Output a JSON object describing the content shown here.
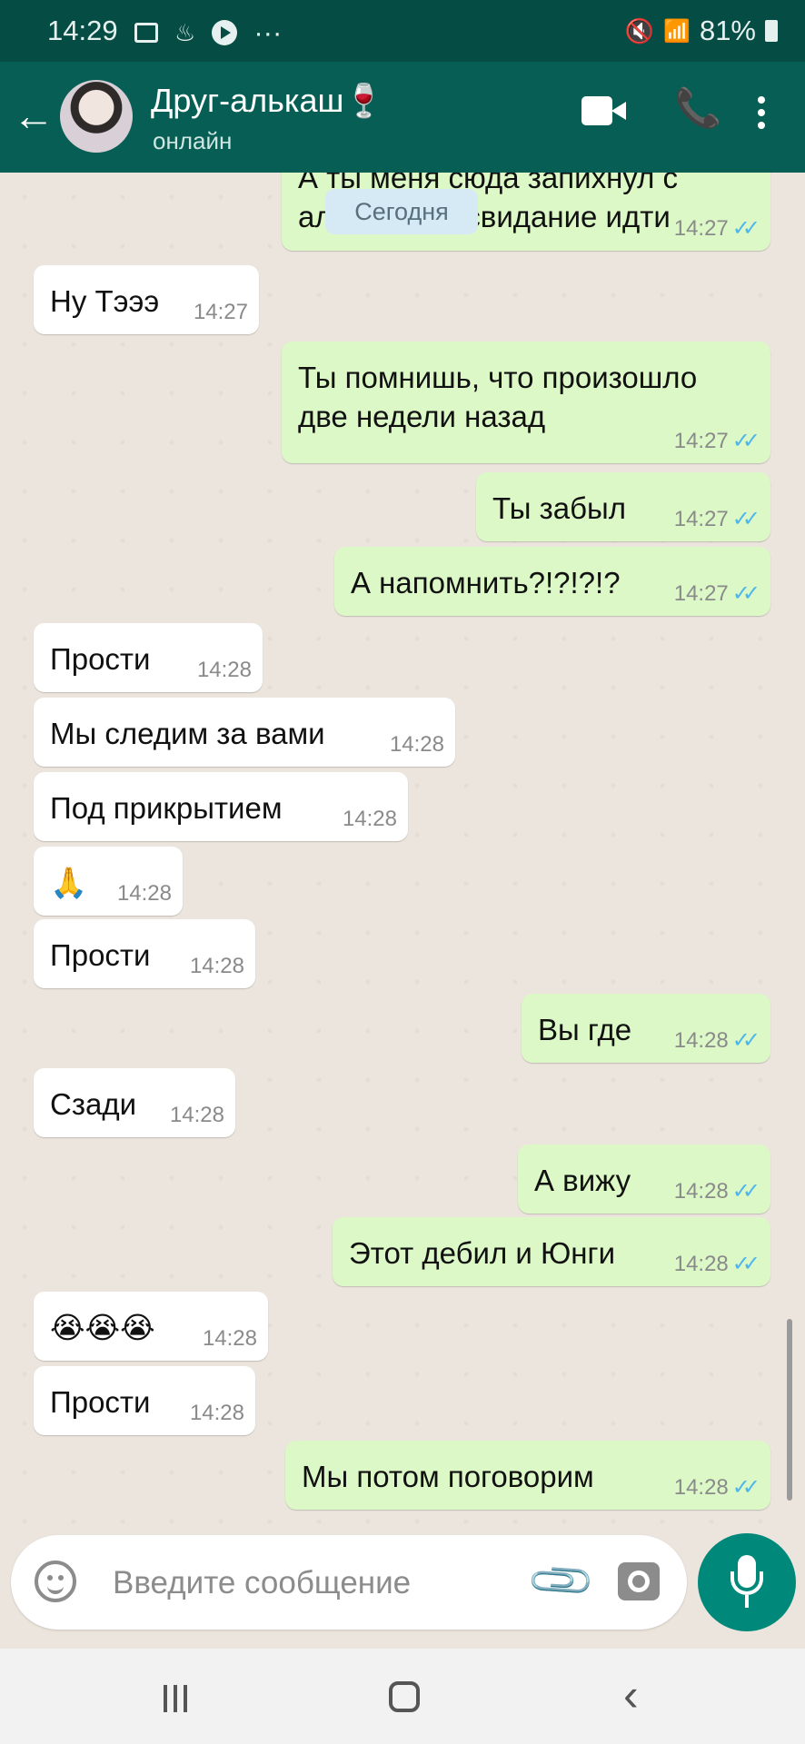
{
  "status_bar": {
    "time": "14:29",
    "more": "···",
    "signal": "📶",
    "battery": "81%"
  },
  "header": {
    "back_icon": "←",
    "contact_name": "Друг-алькаш🍷",
    "status": "онлайн",
    "call_icon": "📞"
  },
  "date_separator": "Сегодня",
  "messages": [
    {
      "dir": "out",
      "text": "А ты меня сюда запихнул с\nал                свидание идти",
      "time": "14:27"
    },
    {
      "dir": "in",
      "text": "Ну Тэээ",
      "time": "14:27"
    },
    {
      "dir": "out",
      "text": "Ты помнишь, что произошло\nдве недели назад",
      "time": "14:27"
    },
    {
      "dir": "out",
      "text": "Ты забыл",
      "time": "14:27"
    },
    {
      "dir": "out",
      "text": "А напомнить?!?!?!?",
      "time": "14:27"
    },
    {
      "dir": "in",
      "text": "Прости",
      "time": "14:28"
    },
    {
      "dir": "in",
      "text": "Мы следим за вами",
      "time": "14:28"
    },
    {
      "dir": "in",
      "text": "Под прикрытием",
      "time": "14:28"
    },
    {
      "dir": "in",
      "text": "🙏",
      "time": "14:28"
    },
    {
      "dir": "in",
      "text": "Прости",
      "time": "14:28"
    },
    {
      "dir": "out",
      "text": "Вы где",
      "time": "14:28"
    },
    {
      "dir": "in",
      "text": "Сзади",
      "time": "14:28"
    },
    {
      "dir": "out",
      "text": "А вижу",
      "time": "14:28"
    },
    {
      "dir": "out",
      "text": "Этот дебил и Юнги",
      "time": "14:28"
    },
    {
      "dir": "in",
      "text": "😭😭😭",
      "time": "14:28"
    },
    {
      "dir": "in",
      "text": "Прости",
      "time": "14:28"
    },
    {
      "dir": "out",
      "text": "Мы потом поговорим",
      "time": "14:28"
    }
  ],
  "ticks": "✓✓",
  "input": {
    "placeholder": "Введите сообщение",
    "attach_icon": "📎"
  },
  "nav": {
    "back": "‹"
  },
  "colors": {
    "header": "#075e54",
    "status_bar": "#054d44",
    "outgoing_bubble": "#dcf8c6",
    "incoming_bubble": "#ffffff",
    "read_ticks": "#4fb6ec",
    "mic_button": "#00897b"
  }
}
